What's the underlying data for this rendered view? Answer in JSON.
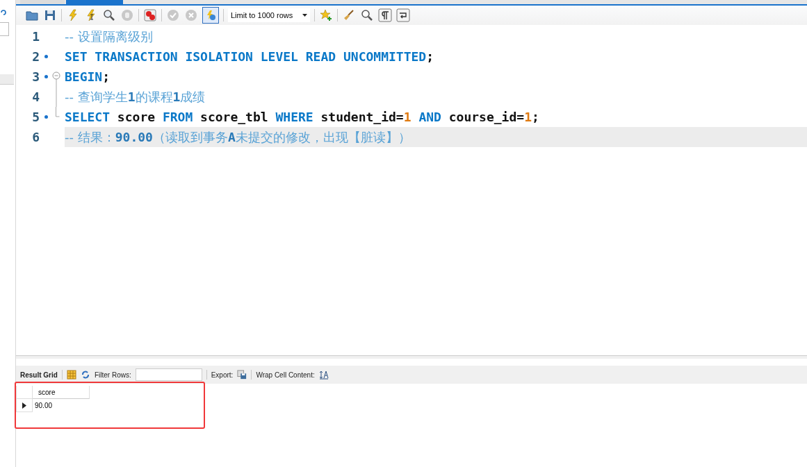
{
  "tabs": [
    {
      "selected": false
    },
    {
      "selected": true
    }
  ],
  "toolbar": {
    "limit_select": "Limit to 1000 rows",
    "autocommit_on": true
  },
  "editor": {
    "lines": [
      {
        "number": "1",
        "statement": false,
        "kind": "plain",
        "highlighted": false,
        "tokens": [
          {
            "kind": "comment",
            "text": "-- 设置隔离级别"
          }
        ]
      },
      {
        "number": "2",
        "statement": true,
        "kind": "plain",
        "highlighted": false,
        "tokens": [
          {
            "kind": "keyword",
            "text": "SET TRANSACTION ISOLATION LEVEL READ UNCOMMITTED"
          },
          {
            "kind": "plain",
            "text": ";"
          }
        ]
      },
      {
        "number": "3",
        "statement": true,
        "kind": "fold-start",
        "highlighted": false,
        "tokens": [
          {
            "kind": "keyword",
            "text": "BEGIN"
          },
          {
            "kind": "plain",
            "text": ";"
          }
        ]
      },
      {
        "number": "4",
        "statement": false,
        "kind": "fold-mid",
        "highlighted": false,
        "tokens": [
          {
            "kind": "comment",
            "text": "-- 查询学生"
          },
          {
            "kind": "comment-strong",
            "text": "1"
          },
          {
            "kind": "comment",
            "text": "的课程"
          },
          {
            "kind": "comment-strong",
            "text": "1"
          },
          {
            "kind": "comment",
            "text": "成绩"
          }
        ]
      },
      {
        "number": "5",
        "statement": true,
        "kind": "fold-end",
        "highlighted": false,
        "tokens": [
          {
            "kind": "keyword",
            "text": "SELECT"
          },
          {
            "kind": "plain",
            "text": " score "
          },
          {
            "kind": "keyword",
            "text": "FROM"
          },
          {
            "kind": "plain",
            "text": " score_tbl "
          },
          {
            "kind": "keyword",
            "text": "WHERE"
          },
          {
            "kind": "plain",
            "text": " student_id="
          },
          {
            "kind": "number",
            "text": "1"
          },
          {
            "kind": "keyword",
            "text": " AND"
          },
          {
            "kind": "plain",
            "text": " course_id="
          },
          {
            "kind": "number",
            "text": "1"
          },
          {
            "kind": "plain",
            "text": ";"
          }
        ]
      },
      {
        "number": "6",
        "statement": false,
        "kind": "plain",
        "highlighted": true,
        "tokens": [
          {
            "kind": "comment",
            "text": "-- 结果："
          },
          {
            "kind": "comment-strong",
            "text": "90.00"
          },
          {
            "kind": "comment",
            "text": "（读取到事务"
          },
          {
            "kind": "comment-strong",
            "text": "A"
          },
          {
            "kind": "comment",
            "text": "未提交的修改，出现【脏读】）"
          }
        ]
      }
    ]
  },
  "result": {
    "tab": "Result Grid",
    "filter_label": "Filter Rows:",
    "export_label": "Export:",
    "wrap_label": "Wrap Cell Content:",
    "columns": [
      "score"
    ],
    "rows": [
      {
        "selected": true,
        "cells": [
          "90.00"
        ]
      }
    ]
  }
}
